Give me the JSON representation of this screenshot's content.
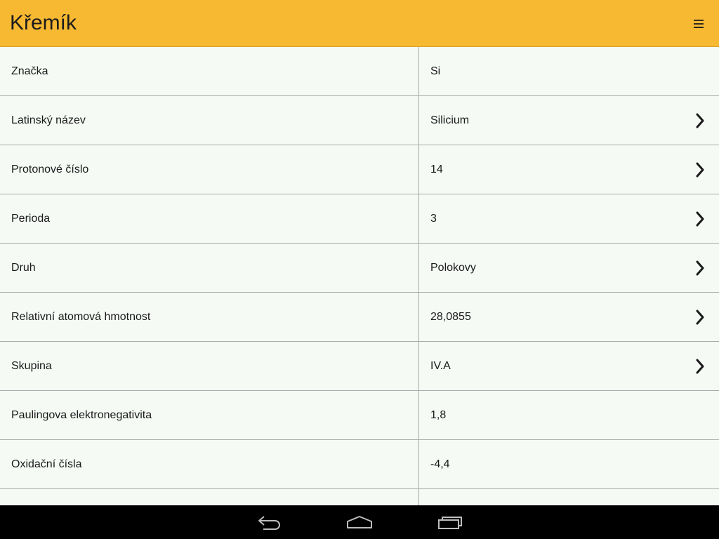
{
  "app_bar": {
    "title": "Křemík",
    "background": "#f8b932",
    "menu_icon": "hamburger-icon"
  },
  "rows": [
    {
      "label": "Značka",
      "value": "Si",
      "has_chevron": false
    },
    {
      "label": "Latinský název",
      "value": "Silicium",
      "has_chevron": true
    },
    {
      "label": "Protonové číslo",
      "value": "14",
      "has_chevron": true
    },
    {
      "label": "Perioda",
      "value": "3",
      "has_chevron": true
    },
    {
      "label": "Druh",
      "value": "Polokovy",
      "has_chevron": true
    },
    {
      "label": "Relativní atomová hmotnost",
      "value": "28,0855",
      "has_chevron": true
    },
    {
      "label": "Skupina",
      "value": "IV.A",
      "has_chevron": true
    },
    {
      "label": "Paulingova elektronegativita",
      "value": "1,8",
      "has_chevron": false
    },
    {
      "label": "Oxidační čísla",
      "value": "-4,4",
      "has_chevron": false
    },
    {
      "label": "",
      "value": "",
      "has_chevron": false
    }
  ],
  "nav_bar": {
    "buttons": [
      "back-icon",
      "home-icon",
      "recent-apps-icon"
    ]
  }
}
